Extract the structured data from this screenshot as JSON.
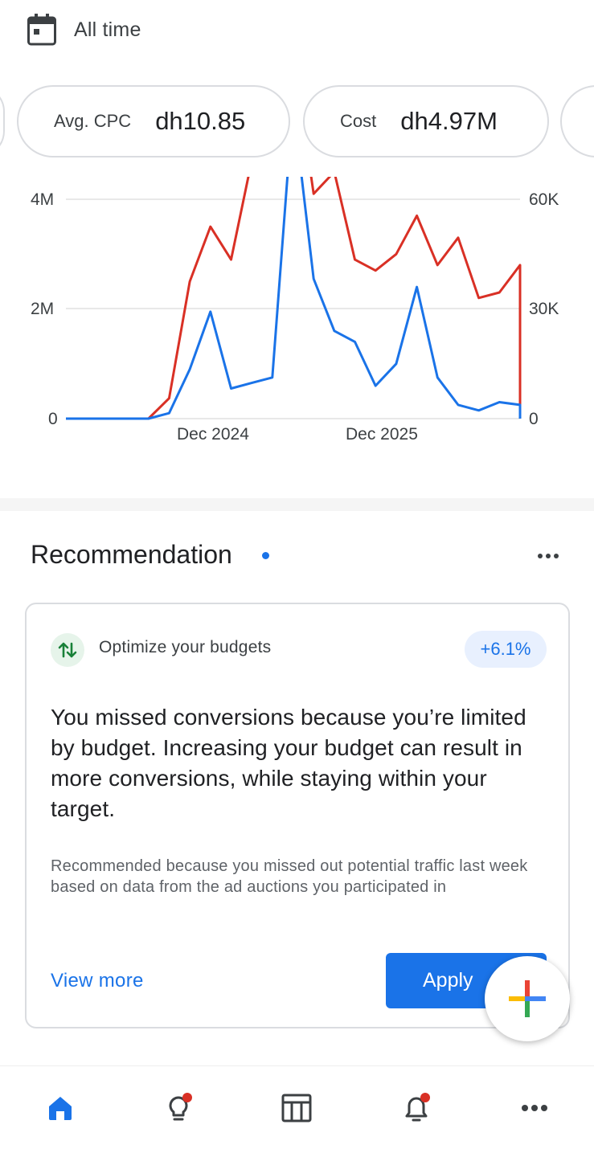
{
  "date_range": {
    "label": "All time",
    "icon": "calendar-icon"
  },
  "metrics": [
    {
      "label": "Avg. CPC",
      "value": "dh10.85"
    },
    {
      "label": "Cost",
      "value": "dh4.97M"
    }
  ],
  "chart_data": {
    "type": "line",
    "title": "",
    "x_tick_labels": [
      "Dec 2024",
      "Dec 2025"
    ],
    "y_left": {
      "ticks": [
        "4M",
        "2M",
        "0"
      ],
      "ylim": [
        0,
        4000000
      ]
    },
    "y_right": {
      "ticks": [
        "60K",
        "30K",
        "0"
      ],
      "ylim": [
        0,
        60000
      ]
    },
    "grid": true,
    "legend": "none",
    "x_index": [
      0,
      1,
      2,
      3,
      4,
      5,
      6,
      7,
      8,
      9,
      10,
      11,
      12,
      13,
      14,
      15,
      16,
      17,
      18,
      19,
      20,
      21,
      22
    ],
    "series": [
      {
        "color": "#d93025",
        "axis": "left",
        "values": [
          0,
          0,
          0,
          0,
          0,
          370000,
          2500000,
          3500000,
          2900000,
          4700000,
          5100000,
          6700000,
          4100000,
          4500000,
          2900000,
          2700000,
          3000000,
          3700000,
          2800000,
          3300000,
          2200000,
          2300000,
          2800000
        ]
      },
      {
        "color": "#1a73e8",
        "axis": "left",
        "values": [
          0,
          0,
          0,
          0,
          0,
          100000,
          900000,
          1950000,
          550000,
          650000,
          750000,
          5750000,
          2550000,
          1600000,
          1400000,
          600000,
          1000000,
          2400000,
          750000,
          250000,
          150000,
          300000,
          250000
        ]
      }
    ]
  },
  "recommendation": {
    "section_title": "Recommendation",
    "type_label": "Optimize your budgets",
    "impact_badge": "+6.1%",
    "headline": "You missed conversions because you’re limited by budget. Increasing your budget can result in more conversions, while staying within your target.",
    "reason": "Recommended because you missed out potential traffic last week based on data from the ad auctions you participated in",
    "view_more_label": "View more",
    "apply_label": "Apply"
  },
  "fab": {
    "icon": "plus-icon",
    "colors": [
      "#ea4335",
      "#4285f4",
      "#34a853",
      "#fbbc04"
    ]
  },
  "bottom_nav": [
    {
      "name": "home",
      "icon": "home-icon",
      "active": true
    },
    {
      "name": "insights",
      "icon": "lightbulb-icon",
      "badge": true
    },
    {
      "name": "campaigns",
      "icon": "table-icon"
    },
    {
      "name": "notifications",
      "icon": "bell-icon",
      "badge": true
    },
    {
      "name": "more",
      "icon": "more-icon"
    }
  ],
  "colors": {
    "accent": "#1a73e8",
    "badge_red": "#d93025"
  }
}
